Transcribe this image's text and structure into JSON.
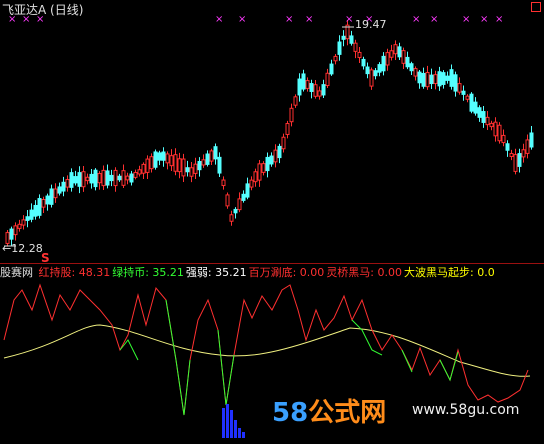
{
  "window": {
    "title": "飞亚达A (日线)"
  },
  "price_chart": {
    "high_label": "19.47",
    "low_label": "12.28",
    "signal_mark": "S",
    "up_color": "#ff3030",
    "down_color": "#54ffff",
    "marker_color": "#ff3cff"
  },
  "indicator": {
    "name": "股赛网",
    "items": [
      {
        "label": "红持股:",
        "value": "48.31",
        "color": "#ff3030"
      },
      {
        "label": "绿持币:",
        "value": "35.21",
        "color": "#33ff33"
      },
      {
        "label": "强弱:",
        "value": "35.21",
        "color": "#ffffff"
      },
      {
        "label": "百万涮底:",
        "value": "0.00",
        "color": "#ff3030"
      },
      {
        "label": "灵桥黑马:",
        "value": "0.00",
        "color": "#ff3030"
      },
      {
        "label": "大波黑马起步:",
        "value": "0.0",
        "color": "#ffff00"
      }
    ]
  },
  "watermark": {
    "num": "58",
    "text": "公式网",
    "url": "www.58gu.com"
  }
}
